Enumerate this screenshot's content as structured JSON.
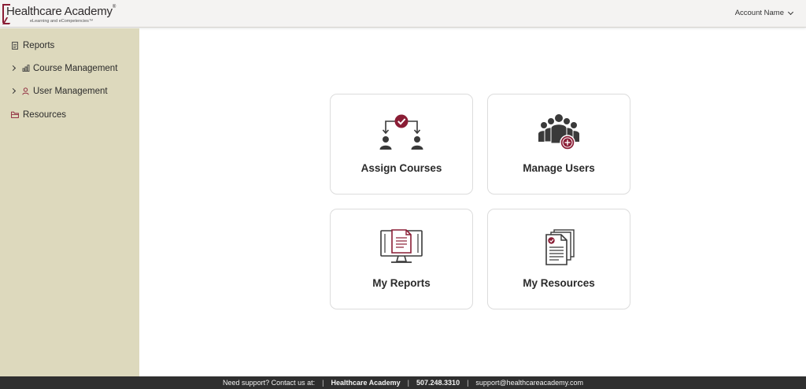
{
  "header": {
    "brand_name": "Healthcare Academy",
    "brand_reg": "®",
    "brand_tagline": "eLearning and eCompetencies™",
    "account_label": "Account Name"
  },
  "sidebar": {
    "items": [
      {
        "label": "Reports",
        "icon": "document-icon",
        "expandable": false
      },
      {
        "label": "Course Management",
        "icon": "bar-chart-icon",
        "expandable": true
      },
      {
        "label": "User Management",
        "icon": "user-icon",
        "expandable": true
      },
      {
        "label": "Resources",
        "icon": "folder-icon",
        "expandable": false
      }
    ]
  },
  "cards": [
    {
      "label": "Assign Courses",
      "icon": "assign-courses-icon"
    },
    {
      "label": "Manage Users",
      "icon": "manage-users-icon"
    },
    {
      "label": "My Reports",
      "icon": "monitor-report-icon"
    },
    {
      "label": "My Resources",
      "icon": "documents-stack-icon"
    }
  ],
  "footer": {
    "support_text": "Need support? Contact us at:",
    "brand": "Healthcare Academy",
    "phone": "507.248.3310",
    "email": "support@healthcareacademy.com"
  },
  "colors": {
    "accent": "#8a1d35",
    "sidebar_bg": "#ddd9bd",
    "topbar_bg": "#f4f3f2",
    "footer_bg": "#2f2f2f",
    "icon_dark": "#3a3a3a"
  }
}
